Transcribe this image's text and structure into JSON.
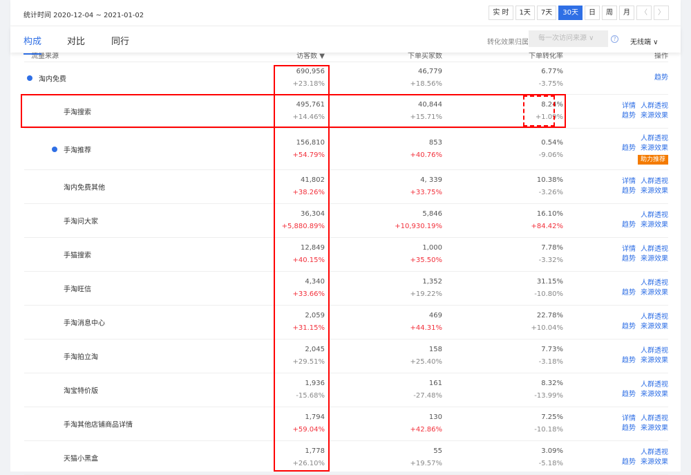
{
  "period": "统计时间 2020-12-04 ~ 2021-01-02",
  "time_buttons": [
    "实 时",
    "1天",
    "7天",
    "30天",
    "日",
    "周",
    "月"
  ],
  "active_time": "30天",
  "tabs": [
    "构成",
    "对比",
    "同行"
  ],
  "attribution": {
    "label": "转化效果归属于：",
    "value": "每一次访问来源 ∨",
    "help": "?"
  },
  "device": "无线端 ∨",
  "columns": [
    "流量来源",
    "访客数 ▼",
    "下单买家数",
    "下单转化率",
    "操作"
  ],
  "rows": [
    {
      "name": "淘内免费",
      "level": 0,
      "dot": true,
      "visitors": "690,956",
      "visitors_chg": "+23.18%",
      "vu": false,
      "buyers": "46,779",
      "buyers_chg": "+18.56%",
      "bu": false,
      "rate": "6.77%",
      "rate_chg": "-3.75%",
      "ru": false,
      "actions": [
        "趋势"
      ]
    },
    {
      "name": "手淘搜索",
      "level": 1,
      "dot": false,
      "visitors": "495,761",
      "visitors_chg": "+14.46%",
      "vu": false,
      "buyers": "40,844",
      "buyers_chg": "+15.71%",
      "bu": false,
      "rate": "8.24%",
      "rate_chg": "+1.09%",
      "ru": false,
      "actions": [
        "详情",
        "人群透视",
        "趋势",
        "来源效果"
      ]
    },
    {
      "name": "手淘推荐",
      "level": 1,
      "dot": true,
      "visitors": "156,810",
      "visitors_chg": "+54.79%",
      "vu": true,
      "buyers": "853",
      "buyers_chg": "+40.76%",
      "bu": true,
      "rate": "0.54%",
      "rate_chg": "-9.06%",
      "ru": false,
      "actions": [
        "",
        "人群透视",
        "趋势",
        "来源效果"
      ],
      "boost": "助力推荐"
    },
    {
      "name": "淘内免费其他",
      "level": 1,
      "dot": false,
      "visitors": "41,802",
      "visitors_chg": "+38.26%",
      "vu": true,
      "buyers": "4, 339",
      "buyers_chg": "+33.75%",
      "bu": true,
      "rate": "10.38%",
      "rate_chg": "-3.26%",
      "ru": false,
      "actions": [
        "详情",
        "人群透视",
        "趋势",
        "来源效果"
      ]
    },
    {
      "name": "手淘问大家",
      "level": 1,
      "dot": false,
      "visitors": "36,304",
      "visitors_chg": "+5,880.89%",
      "vu": true,
      "buyers": "5,846",
      "buyers_chg": "+10,930.19%",
      "bu": true,
      "rate": "16.10%",
      "rate_chg": "+84.42%",
      "ru": true,
      "actions": [
        "",
        "人群透视",
        "趋势",
        "来源效果"
      ]
    },
    {
      "name": "手猫搜索",
      "level": 1,
      "dot": false,
      "visitors": "12,849",
      "visitors_chg": "+40.15%",
      "vu": true,
      "buyers": "1,000",
      "buyers_chg": "+35.50%",
      "bu": true,
      "rate": "7.78%",
      "rate_chg": "-3.32%",
      "ru": false,
      "actions": [
        "详情",
        "人群透视",
        "趋势",
        "来源效果"
      ]
    },
    {
      "name": "手淘旺信",
      "level": 1,
      "dot": false,
      "visitors": "4,340",
      "visitors_chg": "+33.66%",
      "vu": true,
      "buyers": "1,352",
      "buyers_chg": "+19.22%",
      "bu": false,
      "rate": "31.15%",
      "rate_chg": "-10.80%",
      "ru": false,
      "actions": [
        "",
        "人群透视",
        "趋势",
        "来源效果"
      ]
    },
    {
      "name": "手淘消息中心",
      "level": 1,
      "dot": false,
      "visitors": "2,059",
      "visitors_chg": "+31.15%",
      "vu": true,
      "buyers": "469",
      "buyers_chg": "+44.31%",
      "bu": true,
      "rate": "22.78%",
      "rate_chg": "+10.04%",
      "ru": false,
      "actions": [
        "",
        "人群透视",
        "趋势",
        "来源效果"
      ]
    },
    {
      "name": "手淘拍立淘",
      "level": 1,
      "dot": false,
      "visitors": "2,045",
      "visitors_chg": "+29.51%",
      "vu": false,
      "buyers": "158",
      "buyers_chg": "+25.40%",
      "bu": false,
      "rate": "7.73%",
      "rate_chg": "-3.18%",
      "ru": false,
      "actions": [
        "",
        "人群透视",
        "趋势",
        "来源效果"
      ]
    },
    {
      "name": "淘宝特价版",
      "level": 1,
      "dot": false,
      "visitors": "1,936",
      "visitors_chg": "-15.68%",
      "vu": false,
      "buyers": "161",
      "buyers_chg": "-27.48%",
      "bu": false,
      "rate": "8.32%",
      "rate_chg": "-13.99%",
      "ru": false,
      "actions": [
        "",
        "人群透视",
        "趋势",
        "来源效果"
      ]
    },
    {
      "name": "手淘其他店铺商品详情",
      "level": 1,
      "dot": false,
      "visitors": "1,794",
      "visitors_chg": "+59.04%",
      "vu": true,
      "buyers": "130",
      "buyers_chg": "+42.86%",
      "bu": true,
      "rate": "7.25%",
      "rate_chg": "-10.18%",
      "ru": false,
      "actions": [
        "详情",
        "人群透视",
        "趋势",
        "来源效果"
      ]
    },
    {
      "name": "天猫小黑盒",
      "level": 1,
      "dot": false,
      "visitors": "1,778",
      "visitors_chg": "+26.10%",
      "vu": false,
      "buyers": "55",
      "buyers_chg": "+19.57%",
      "bu": false,
      "rate": "3.09%",
      "rate_chg": "-5.18%",
      "ru": false,
      "actions": [
        "",
        "人群透视",
        "趋势",
        "来源效果"
      ]
    }
  ],
  "colors": {
    "accent": "#2f6fe5",
    "up": "#f2303b",
    "annotation": "#ff0000",
    "boost": "#f47b00"
  }
}
